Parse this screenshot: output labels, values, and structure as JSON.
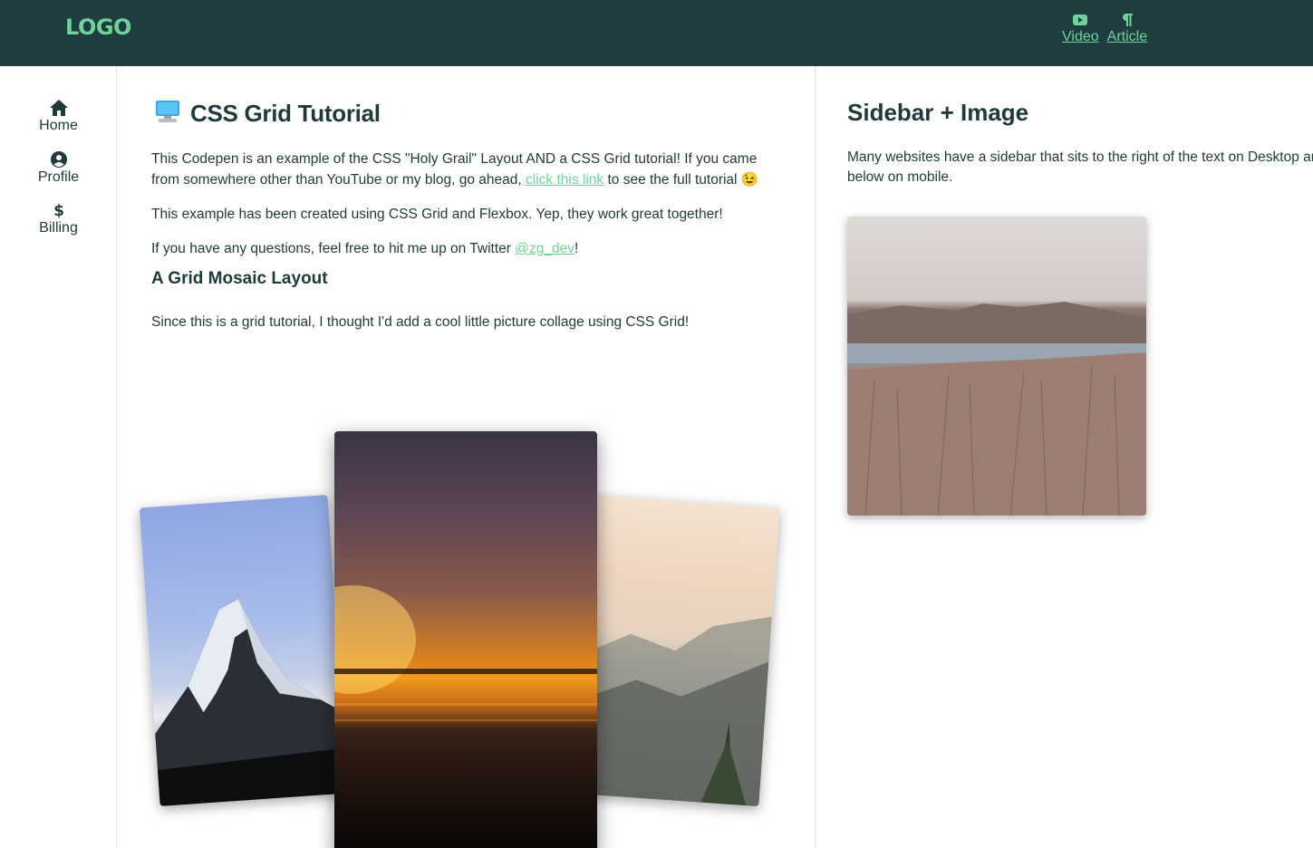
{
  "header": {
    "logo": "LOGO",
    "nav": [
      {
        "label": "Video",
        "icon": "youtube-icon"
      },
      {
        "label": "Article",
        "icon": "paragraph-icon"
      }
    ]
  },
  "left_nav": {
    "items": [
      {
        "label": "Home",
        "icon": "home-icon"
      },
      {
        "label": "Profile",
        "icon": "user-circle-icon"
      },
      {
        "label": "Billing",
        "icon": "dollar-icon"
      }
    ]
  },
  "main": {
    "title_icon": "computer-icon",
    "title": "CSS Grid Tutorial",
    "p1_before": "This Codepen is an example of the CSS \"Holy Grail\" Layout AND a CSS Grid tutorial! If you came from somewhere other than YouTube or my blog, go ahead, ",
    "p1_link": "click this link",
    "p1_after": " to see the full tutorial ",
    "p1_emoji": "😉",
    "p2": "This example has been created using CSS Grid and Flexbox. Yep, they work great together!",
    "p3_before": "If you have any questions, feel free to hit me up on Twitter ",
    "p3_link": "@zg_dev",
    "p3_after": "!",
    "subheading": "A Grid Mosaic Layout",
    "p4": "Since this is a grid tutorial, I thought I'd add a cool little picture collage using CSS Grid!",
    "photos": [
      {
        "subject": "snowy-mountain-photo"
      },
      {
        "subject": "sunset-photo"
      },
      {
        "subject": "valley-photo"
      }
    ]
  },
  "sidebar": {
    "title": "Sidebar + Image",
    "text": "Many websites have a sidebar that sits to the right of the text on Desktop and below on mobile.",
    "photo": "lake-grass-photo"
  },
  "colors": {
    "header_bg": "#1f3d3f",
    "accent": "#6ed39a",
    "text": "#1e3a3a",
    "divider": "#e3e6e6"
  }
}
